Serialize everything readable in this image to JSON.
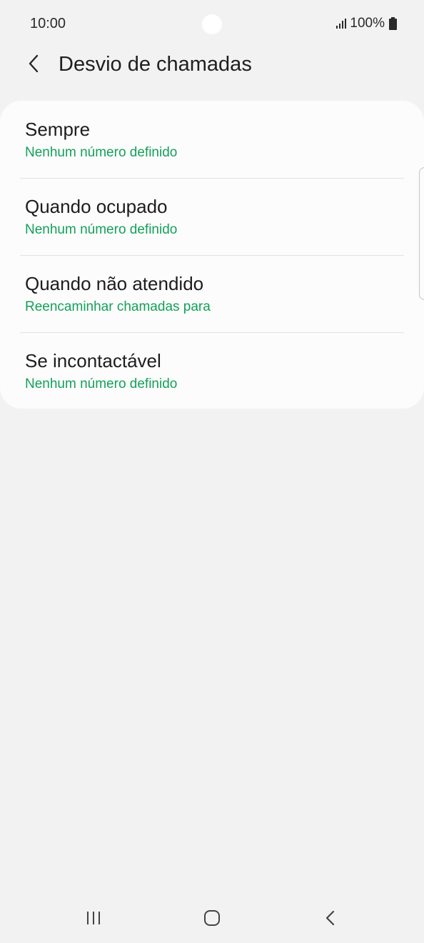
{
  "status_bar": {
    "time": "10:00",
    "battery": "100%",
    "icons": [
      "signal-icon",
      "battery-icon"
    ]
  },
  "header": {
    "title": "Desvio de chamadas",
    "back_icon": "chevron-left-icon"
  },
  "settings": {
    "items": [
      {
        "title": "Sempre",
        "subtitle": "Nenhum número definido"
      },
      {
        "title": "Quando ocupado",
        "subtitle": "Nenhum número definido"
      },
      {
        "title": "Quando não atendido",
        "subtitle": "Reencaminhar chamadas para"
      },
      {
        "title": "Se incontactável",
        "subtitle": "Nenhum número definido"
      }
    ]
  },
  "nav_bar": {
    "icons": [
      "recent-apps-icon",
      "home-icon",
      "back-icon"
    ]
  },
  "colors": {
    "accent_green": "#14a05a",
    "background": "#f2f2f2",
    "card": "#fcfcfc"
  }
}
